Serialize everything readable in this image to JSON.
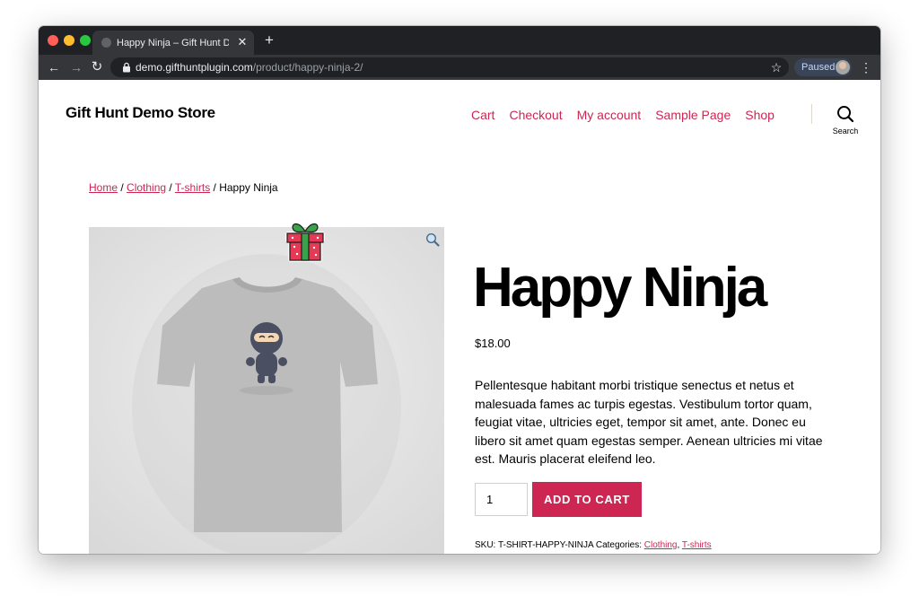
{
  "browser": {
    "tab_title": "Happy Ninja – Gift Hunt Demo Store",
    "tab_close": "✕",
    "new_tab": "+",
    "url_host": "demo.gifthuntplugin.com",
    "url_path": "/product/happy-ninja-2/",
    "paused_label": "Paused"
  },
  "site": {
    "title": "Gift Hunt Demo Store",
    "menu": [
      "Cart",
      "Checkout",
      "My account",
      "Sample Page",
      "Shop"
    ],
    "search_label": "Search",
    "accent": "#cd2653"
  },
  "breadcrumb": {
    "items": [
      "Home",
      "Clothing",
      "T-shirts"
    ],
    "separator": " / ",
    "current": "Happy Ninja"
  },
  "product": {
    "title": "Happy Ninja",
    "price": "$18.00",
    "description": "Pellentesque habitant morbi tristique senectus et netus et malesuada fames ac turpis egestas. Vestibulum tortor quam, feugiat vitae, ultricies eget, tempor sit amet, ante. Donec eu libero sit amet quam egestas semper. Aenean ultricies mi vitae est. Mauris placerat eleifend leo.",
    "quantity": "1",
    "add_to_cart_label": "ADD TO CART",
    "sku_label": "SKU:",
    "sku": "T-SHIRT-HAPPY-NINJA",
    "categories_label": "Categories:",
    "categories": [
      "Clothing",
      "T-shirts"
    ],
    "categories_separator": ", "
  },
  "icons": {
    "zoom": "magnifier-icon",
    "gift": "gift-icon",
    "search": "search-icon"
  }
}
